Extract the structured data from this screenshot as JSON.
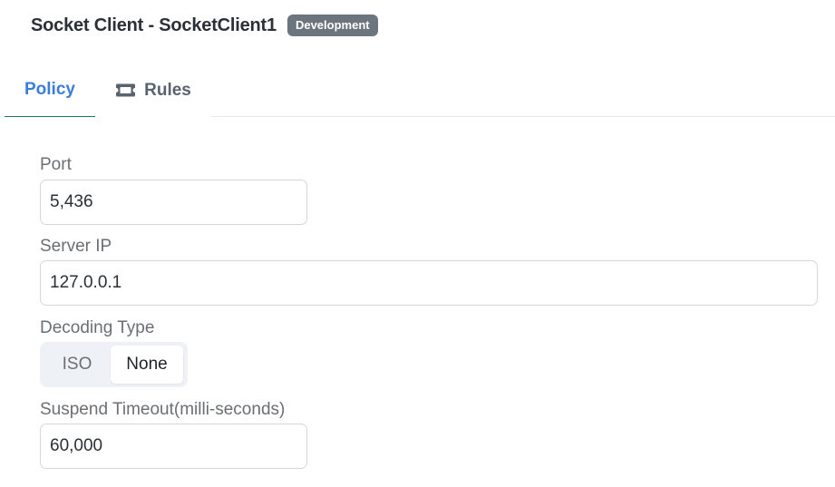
{
  "header": {
    "title": "Socket Client - SocketClient1",
    "badge": "Development"
  },
  "tabs": [
    {
      "label": "Policy",
      "active": true
    },
    {
      "label": "Rules",
      "active": false,
      "icon": "ticket-icon"
    }
  ],
  "form": {
    "port": {
      "label": "Port",
      "value": "5,436"
    },
    "server_ip": {
      "label": "Server IP",
      "value": "127.0.0.1"
    },
    "decoding_type": {
      "label": "Decoding Type",
      "options": [
        "ISO",
        "None"
      ],
      "selected": "None"
    },
    "suspend_timeout": {
      "label": "Suspend Timeout(milli-seconds)",
      "value": "60,000"
    }
  },
  "colors": {
    "accent": "#3b7ddd",
    "badge_bg": "#6c757d",
    "tab_underline": "#1a7a5e"
  }
}
